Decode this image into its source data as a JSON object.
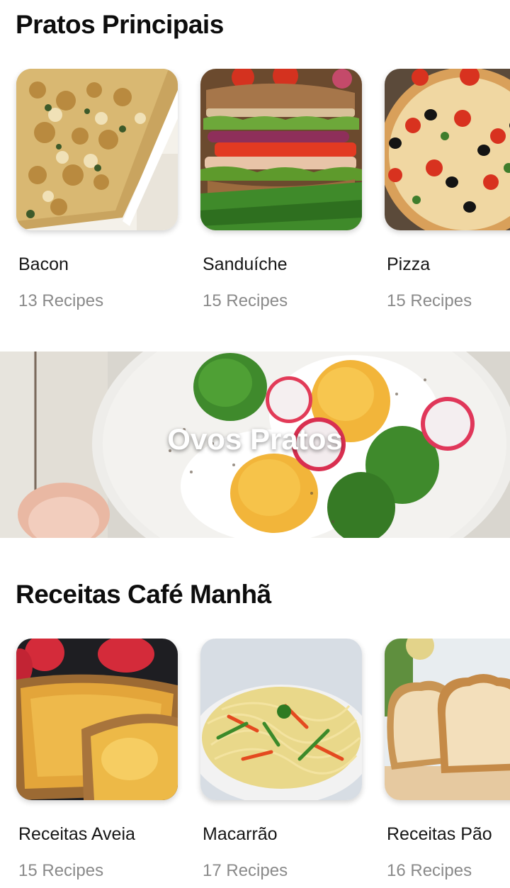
{
  "sections": [
    {
      "title": "Pratos Principais",
      "items": [
        {
          "name": "Bacon",
          "count": "13 Recipes"
        },
        {
          "name": "Sanduíche",
          "count": "15 Recipes"
        },
        {
          "name": "Pizza",
          "count": "15 Recipes"
        }
      ]
    },
    {
      "title": "Receitas Café Manhã",
      "items": [
        {
          "name": "Receitas Aveia",
          "count": "15 Recipes"
        },
        {
          "name": "Macarrão",
          "count": "17 Recipes"
        },
        {
          "name": "Receitas Pão",
          "count": "16 Recipes"
        }
      ]
    }
  ],
  "banner": {
    "title": "Ovos Pratos"
  }
}
